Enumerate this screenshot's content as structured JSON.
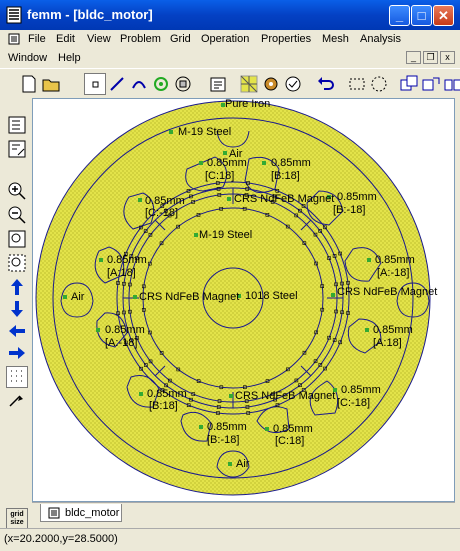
{
  "window": {
    "title": "femm - [bldc_motor]"
  },
  "menu": {
    "row1": [
      "File",
      "Edit",
      "View",
      "Problem",
      "Grid",
      "Operation",
      "Properties",
      "Mesh",
      "Analysis"
    ],
    "row2": [
      "Window",
      "Help"
    ]
  },
  "tab": {
    "label": "bldc_motor"
  },
  "status": {
    "text": "(x=20.2000,y=28.5000)"
  },
  "left_toolbar": {
    "grid_size": "grid size"
  },
  "labels": {
    "pure_iron": "Pure Iron",
    "m19_top": "M-19 Steel",
    "air_top": "Air",
    "m19_inner": "M-19 Steel",
    "steel_1018": "1018 Steel",
    "air_left": "Air",
    "air_bottom": "Air",
    "magnet_top": "CRS NdFeB Magnet",
    "magnet_left": "CRS NdFeB Magnet",
    "magnet_right": "CRS NdFeB Magnet",
    "magnet_bottom": "CRS NdFeB Magnet",
    "coils": [
      {
        "gauge": "0.85mm",
        "circuit": "[C:18]"
      },
      {
        "gauge": "0.85mm",
        "circuit": "[B:18]"
      },
      {
        "gauge": "0.85mm",
        "circuit": "[C:-18]"
      },
      {
        "gauge": "0.85mm",
        "circuit": "[B:-18]"
      },
      {
        "gauge": "0.85mm",
        "circuit": "[A:18]"
      },
      {
        "gauge": "0.85mm",
        "circuit": "[A:-18]"
      },
      {
        "gauge": "0.85mm",
        "circuit": "[A:-18]"
      },
      {
        "gauge": "0.85mm",
        "circuit": "[A:18]"
      },
      {
        "gauge": "0.85mm",
        "circuit": "[B:18]"
      },
      {
        "gauge": "0.85mm",
        "circuit": "[C:-18]"
      },
      {
        "gauge": "0.85mm",
        "circuit": "[B:-18]"
      },
      {
        "gauge": "0.85mm",
        "circuit": "[C:18]"
      }
    ]
  },
  "colors": {
    "mesh_fill": "#e3e34a",
    "boundary": "#1a1a8c",
    "node": "#000000",
    "label_marker": "#33aa33"
  }
}
